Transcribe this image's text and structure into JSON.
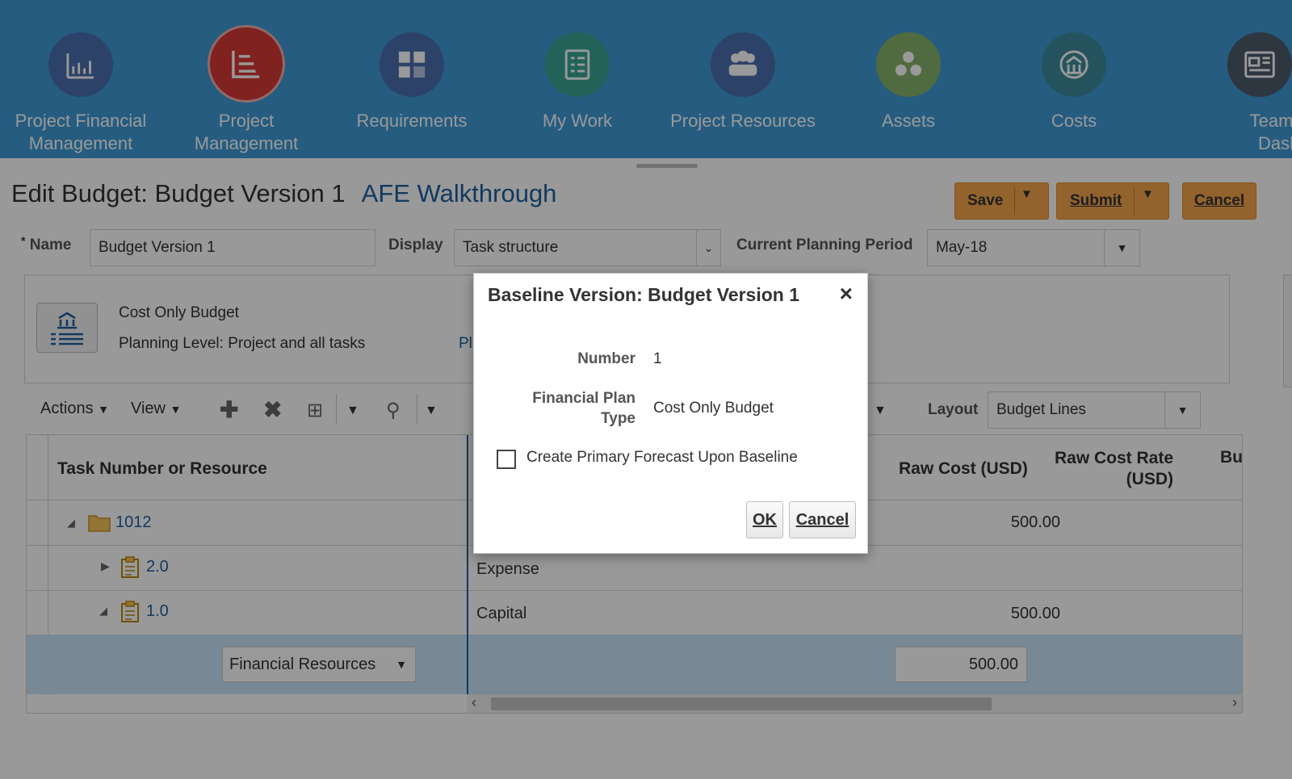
{
  "springboard": {
    "tiles": [
      {
        "label": "Project Financial Management",
        "icon": "bar-chart-icon",
        "color": "#4b6fae"
      },
      {
        "label": "Project Management",
        "icon": "gantt-icon",
        "color": "#d63a36",
        "selected": true
      },
      {
        "label": "Requirements",
        "icon": "puzzle-icon",
        "color": "#4b6fae"
      },
      {
        "label": "My Work",
        "icon": "checklist-icon",
        "color": "#3aa694"
      },
      {
        "label": "Project Resources",
        "icon": "people-icon",
        "color": "#4b6fae"
      },
      {
        "label": "Assets",
        "icon": "dots-icon",
        "color": "#86b36a"
      },
      {
        "label": "Costs",
        "icon": "bank-icon",
        "color": "#3f8a9c"
      },
      {
        "label": "Team Mem Dashboa",
        "icon": "dashboard-icon",
        "color": "#4e5a6b"
      }
    ]
  },
  "page": {
    "title": "Edit Budget: Budget Version 1",
    "project": "AFE Walkthrough",
    "buttons": {
      "save": "Save",
      "submit": "Submit",
      "cancel": "Cancel"
    },
    "fields": {
      "name_label": "Name",
      "name_required": "*",
      "name_value": "Budget Version 1",
      "display_label": "Display",
      "display_value": "Task structure",
      "period_label": "Current Planning Period",
      "period_value": "May-18"
    },
    "info": {
      "plan_type": "Cost Only Budget",
      "planning_level": "Planning Level: Project and all tasks",
      "truncated": "Pl"
    },
    "toolbar": {
      "actions": "Actions",
      "view": "View",
      "layout_label": "Layout",
      "layout_value": "Budget Lines"
    },
    "grid": {
      "headers": {
        "task": "Task Number or Resource",
        "raw_cost": "Raw Cost (USD)",
        "raw_cost_rate": "Raw Cost Rate (USD)",
        "bu": "Bu"
      },
      "rows": [
        {
          "task": "1012",
          "type": "",
          "raw_cost": "500.00"
        },
        {
          "task": "2.0",
          "type": "Expense",
          "raw_cost": ""
        },
        {
          "task": "1.0",
          "type": "Capital",
          "raw_cost": "500.00"
        },
        {
          "task": "Financial Resources",
          "type": "",
          "raw_cost": "500.00"
        }
      ]
    }
  },
  "dialog": {
    "title": "Baseline Version: Budget Version 1",
    "number_label": "Number",
    "number_value": "1",
    "plan_type_label": "Financial Plan Type",
    "plan_type_value": "Cost Only Budget",
    "checkbox_label": "Create Primary Forecast Upon Baseline",
    "checkbox_checked": false,
    "ok": "OK",
    "cancel": "Cancel"
  }
}
